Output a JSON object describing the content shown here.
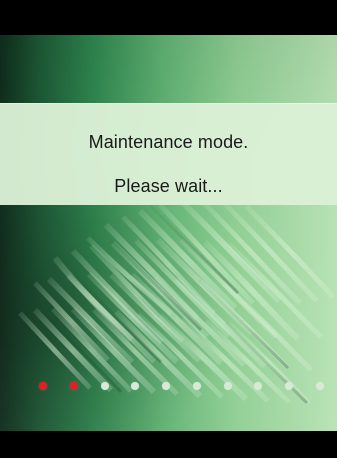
{
  "screen": {
    "message_line_1": "Maintenance mode.",
    "message_line_2": "Please wait..."
  },
  "progress": {
    "total_steps": 10,
    "completed_steps": 2,
    "active_color": "#e11f24",
    "inactive_color": "#d8ead5"
  },
  "theme": {
    "bar_color": "#000000",
    "panel_color": "#dcf0d6",
    "accent_green": "#5fb172"
  }
}
